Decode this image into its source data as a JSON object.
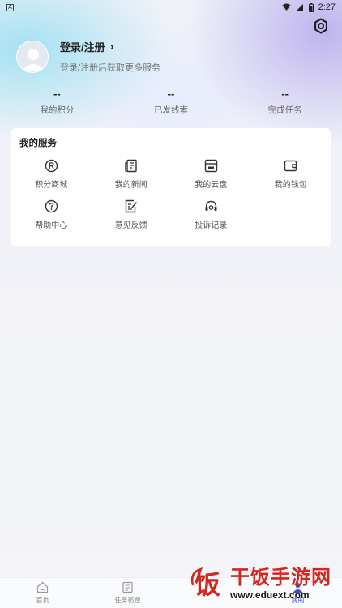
{
  "status_bar": {
    "time": "2:27"
  },
  "profile": {
    "title": "登录/注册",
    "chevron": "›",
    "subtitle": "登录/注册后获取更多服务"
  },
  "stats": [
    {
      "value": "--",
      "label": "我的积分"
    },
    {
      "value": "--",
      "label": "已发线索"
    },
    {
      "value": "--",
      "label": "完成任务"
    }
  ],
  "services": {
    "title": "我的服务",
    "items": [
      {
        "label": "积分商城",
        "icon": "registered-icon"
      },
      {
        "label": "我的新闻",
        "icon": "newspaper-icon"
      },
      {
        "label": "我的云盘",
        "icon": "cloud-drive-icon"
      },
      {
        "label": "我的钱包",
        "icon": "wallet-icon"
      },
      {
        "label": "帮助中心",
        "icon": "help-icon"
      },
      {
        "label": "意见反馈",
        "icon": "feedback-icon"
      },
      {
        "label": "投诉记录",
        "icon": "complaint-headset-icon"
      }
    ]
  },
  "bottom_nav": [
    {
      "label": "首页",
      "icon": "home-icon"
    },
    {
      "label": "任务彷徨",
      "icon": "task-icon"
    },
    {
      "label": "",
      "icon": ""
    },
    {
      "label": "我的",
      "icon": "profile-icon"
    }
  ],
  "watermark": {
    "title": "干饭手游网",
    "url": "www.eduext.com",
    "logo_char": "饭"
  },
  "colors": {
    "accent": "#3b4ed0",
    "watermark_red": "#d3261f"
  }
}
